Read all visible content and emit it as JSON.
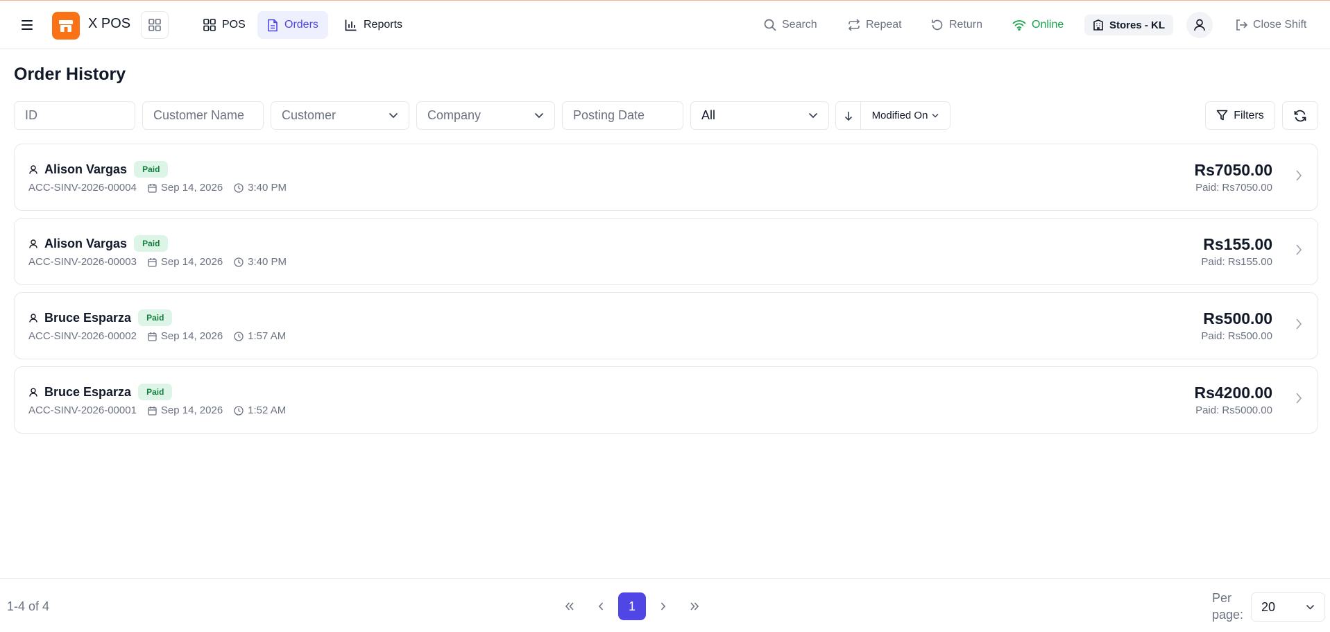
{
  "header": {
    "app_name": "X POS",
    "nav": [
      {
        "label": "POS",
        "icon": "grid-icon"
      },
      {
        "label": "Orders",
        "icon": "document-icon",
        "active": true
      },
      {
        "label": "Reports",
        "icon": "bar-chart-icon"
      }
    ],
    "tools": {
      "search": "Search",
      "repeat": "Repeat",
      "return": "Return",
      "online": "Online",
      "store": "Stores - KL",
      "close_shift": "Close Shift"
    }
  },
  "page": {
    "title": "Order History"
  },
  "filters": {
    "id_placeholder": "ID",
    "customer_name_placeholder": "Customer Name",
    "customer_select": "Customer",
    "company_select": "Company",
    "posting_date_placeholder": "Posting Date",
    "status_select": "All",
    "sort_field": "Modified On",
    "filters_label": "Filters"
  },
  "orders": [
    {
      "customer": "Alison Vargas",
      "status": "Paid",
      "id": "ACC-SINV-2026-00004",
      "date": "Sep 14, 2026",
      "time": "3:40 PM",
      "total": "Rs7050.00",
      "paid": "Paid: Rs7050.00"
    },
    {
      "customer": "Alison Vargas",
      "status": "Paid",
      "id": "ACC-SINV-2026-00003",
      "date": "Sep 14, 2026",
      "time": "3:40 PM",
      "total": "Rs155.00",
      "paid": "Paid: Rs155.00"
    },
    {
      "customer": "Bruce Esparza",
      "status": "Paid",
      "id": "ACC-SINV-2026-00002",
      "date": "Sep 14, 2026",
      "time": "1:57 AM",
      "total": "Rs500.00",
      "paid": "Paid: Rs500.00"
    },
    {
      "customer": "Bruce Esparza",
      "status": "Paid",
      "id": "ACC-SINV-2026-00001",
      "date": "Sep 14, 2026",
      "time": "1:52 AM",
      "total": "Rs4200.00",
      "paid": "Paid: Rs5000.00"
    }
  ],
  "pagination": {
    "range": "1-4 of 4",
    "current_page": "1",
    "per_page_label": "Per page:",
    "per_page": "20"
  },
  "colors": {
    "brand": "#f97316",
    "accent": "#4f46e5",
    "online": "#16a34a",
    "paid_badge_bg": "#dcf5e7",
    "paid_badge_text": "#15803d"
  }
}
